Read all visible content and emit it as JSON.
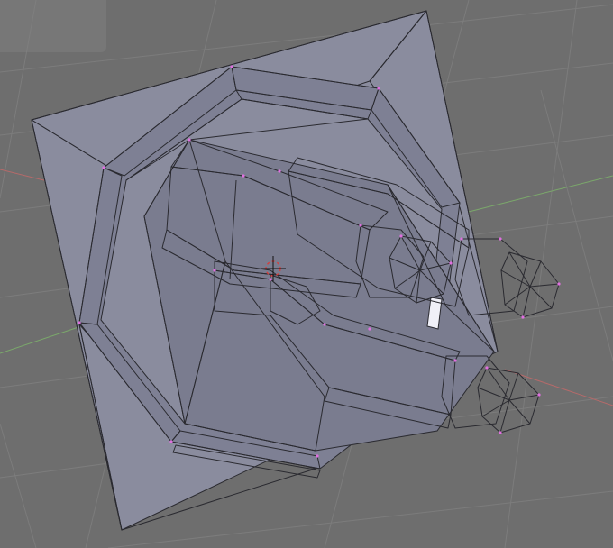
{
  "viewport": {
    "mode": "edit-mode",
    "object": "mesh",
    "colors": {
      "background": "#6e6e6e",
      "grid": "#7c7c7c",
      "x_axis": "#b56a6a",
      "y_axis": "#7ba86b",
      "face": "#8a8c9e",
      "face_dark": "#5e6072",
      "face_light": "#d4d5e6",
      "edge": "#2a2a30",
      "selected_vertex": "#e070e0",
      "cursor": "#d04040"
    }
  }
}
